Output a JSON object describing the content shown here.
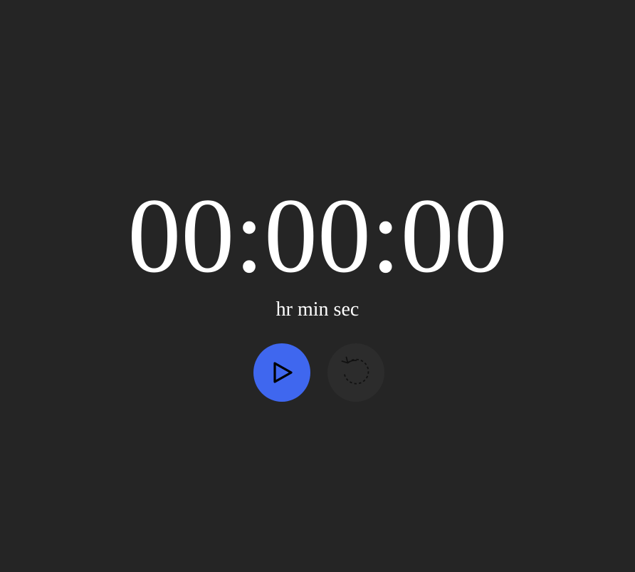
{
  "timer": {
    "hours": "00",
    "minutes": "00",
    "seconds": "00",
    "separator": ":",
    "units": "hr min sec"
  },
  "controls": {
    "start": {
      "icon": "play-icon",
      "color": "#3f67ef"
    },
    "reset": {
      "icon": "reset-icon",
      "color": "#2c2c2c",
      "disabled": true
    }
  },
  "theme": {
    "background": "#252525",
    "text": "#ffffff"
  }
}
